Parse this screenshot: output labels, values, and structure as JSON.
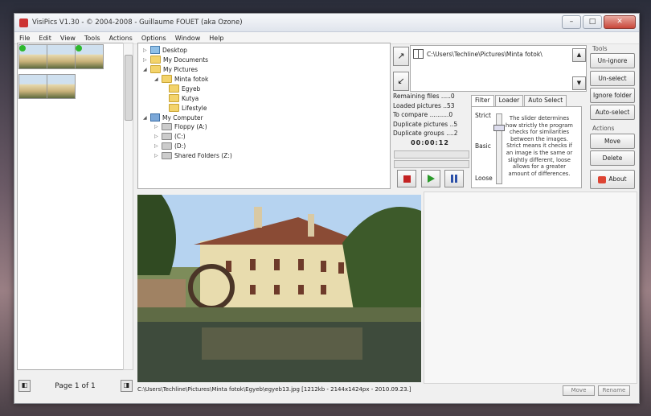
{
  "window": {
    "title": "VisiPics V1.30 - © 2004-2008 - Guillaume FOUET (aka Ozone)"
  },
  "menu": [
    "File",
    "Edit",
    "View",
    "Tools",
    "Actions",
    "Options",
    "Window",
    "Help"
  ],
  "tree": {
    "desktop": "Desktop",
    "my_documents": "My Documents",
    "my_pictures": "My Pictures",
    "minta_fotok": "Minta fotok",
    "egyeb": "Egyeb",
    "kutya": "Kutya",
    "lifestyle": "Lifestyle",
    "my_computer": "My Computer",
    "floppy": "Floppy (A:)",
    "c_drive": "(C:)",
    "d_drive": "(D:)",
    "shared": "Shared Folders (Z:)"
  },
  "folder_list": {
    "path": "C:\\Users\\Techline\\Pictures\\Minta fotok\\"
  },
  "stats": {
    "remaining": "Remaining files .....0",
    "loaded": "Loaded pictures ..53",
    "compare": "To compare ..........0",
    "duplicates": "Duplicate pictures ..5",
    "groups": "Duplicate groups ....2",
    "timer": "00:00:12"
  },
  "tabs": [
    "Filter",
    "Loader",
    "Auto Select"
  ],
  "filter": {
    "strict": "Strict",
    "basic": "Basic",
    "loose": "Loose",
    "tooltip": "The slider determines how strictly the program checks for similarities between the images. Strict means it checks if an image is the same or slightly different, loose allows for a greater amount of differences."
  },
  "tools": {
    "heading": "Tools",
    "unignore": "Un-ignore",
    "unselect": "Un-select",
    "ignore_folder": "Ignore folder",
    "auto_select": "Auto-select"
  },
  "actions": {
    "heading": "Actions",
    "move": "Move",
    "delete": "Delete",
    "about": "About"
  },
  "pager": {
    "label": "Page 1 of 1"
  },
  "status": {
    "path": "C:\\Users\\Techline\\Pictures\\Minta fotok\\Egyeb\\egyeb13.jpg [1212kb - 2144x1424px - 2010.09.23.]"
  },
  "bottom_buttons": {
    "move": "Move",
    "rename": "Rename"
  },
  "colors": {
    "accent": "#2eb82e",
    "sky": "#b6d3f0",
    "wall": "#e8dcae",
    "roof": "#8a4b35",
    "water": "#3e4b3c"
  }
}
